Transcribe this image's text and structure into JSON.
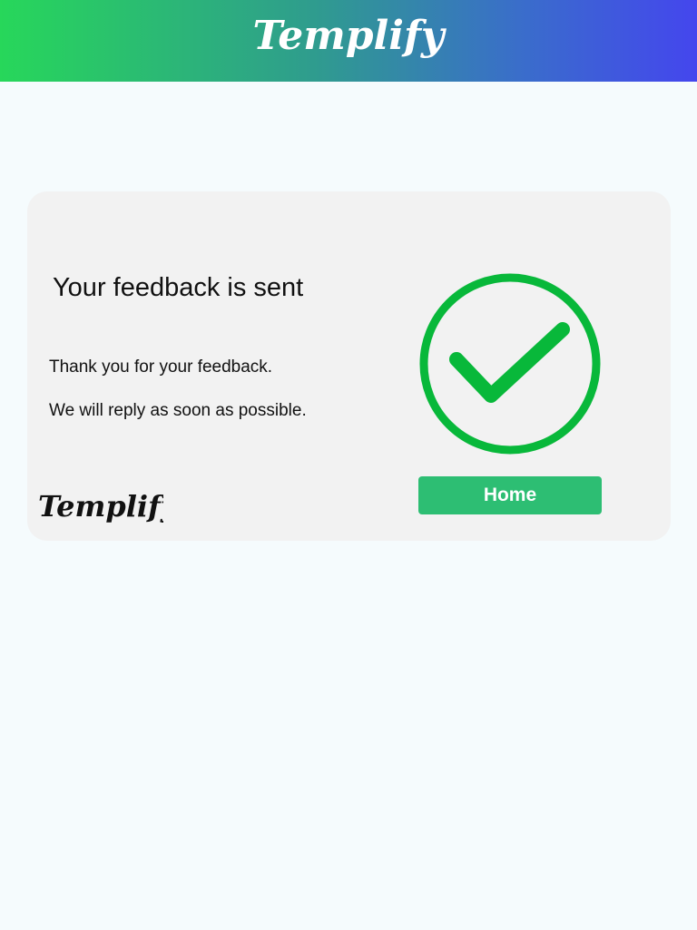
{
  "header": {
    "brand": "Templify",
    "gradient_start": "#27d75a",
    "gradient_end": "#4446ee"
  },
  "card": {
    "title": "Your feedback is sent",
    "message_line1": "Thank you for your feedback.",
    "message_line2": "We will reply as soon as possible.",
    "icon": "check-circle-icon",
    "icon_color": "#08b83a",
    "home_button_label": "Home",
    "button_color": "#2dbe73",
    "footer_brand": "Templify"
  }
}
